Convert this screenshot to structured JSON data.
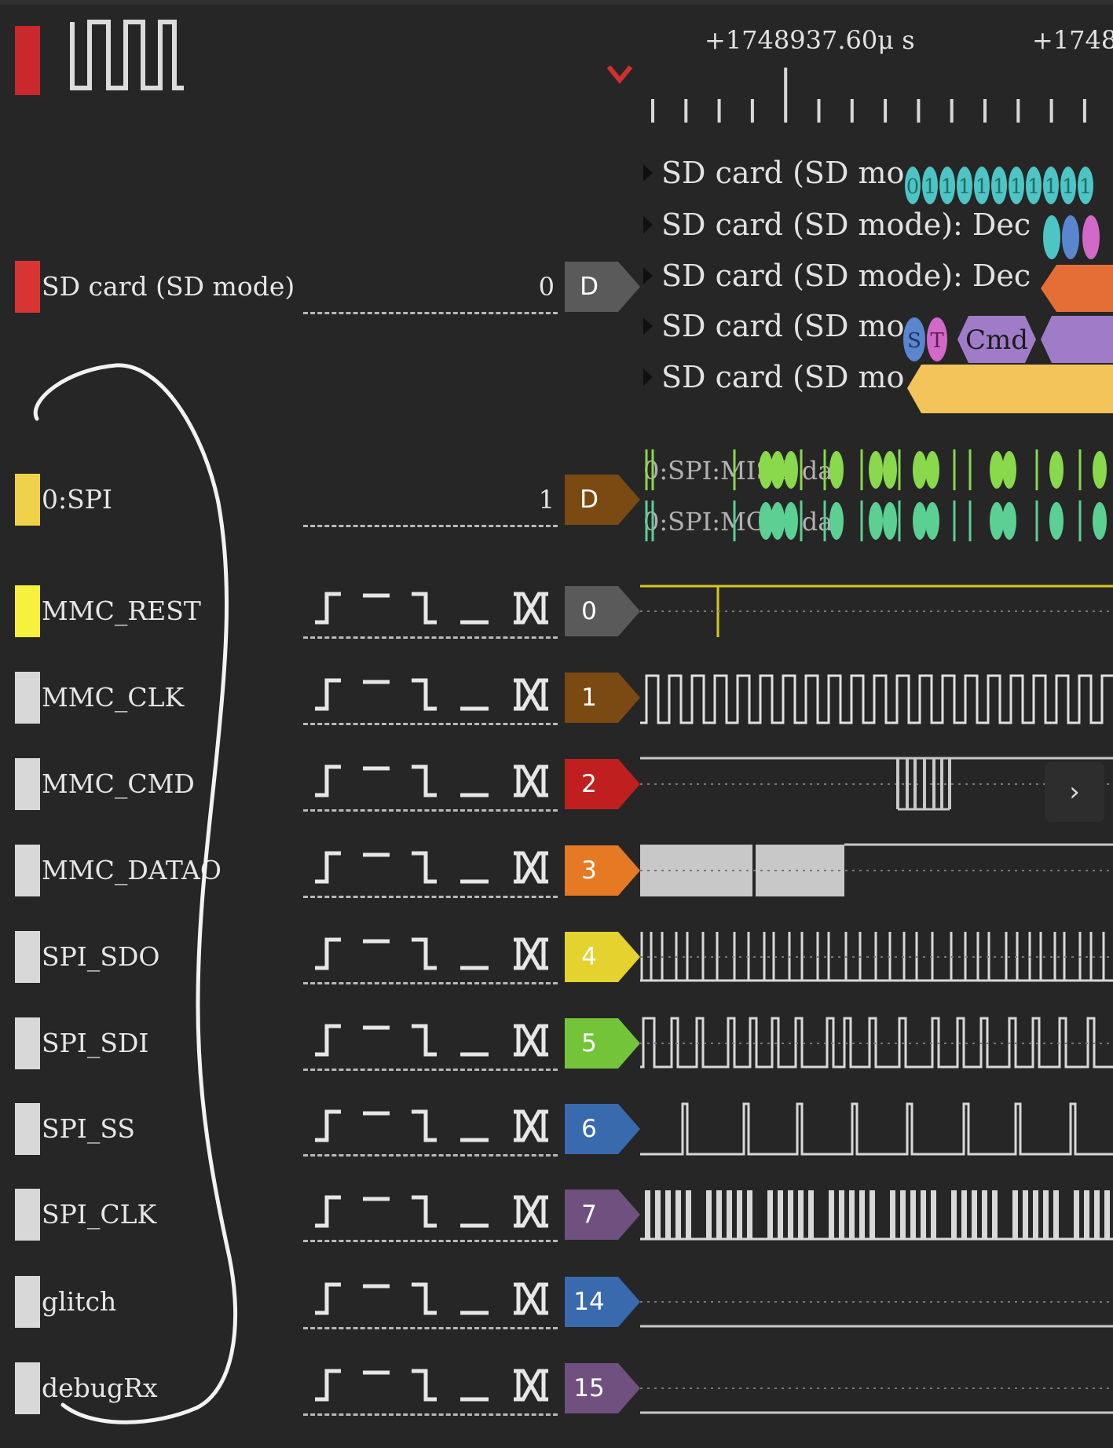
{
  "app": {
    "logo_icon": "square-wave-logo-icon",
    "accent_color": "#c9282d"
  },
  "timeline": {
    "timestamps": [
      "+1748937.60μ s",
      "+1748"
    ],
    "marker_icon": "trigger-marker-icon"
  },
  "channels": [
    {
      "key": "sd",
      "name": "SD card (SD mode)",
      "swatch_color": "#d93434",
      "value": "0",
      "tag": "D",
      "tag_color": "#5a5a5a",
      "kind": "decoder"
    },
    {
      "key": "spi",
      "name": "0:SPI",
      "swatch_color": "#f0d24a",
      "value": "1",
      "tag": "D",
      "tag_color": "#7a4a12",
      "kind": "decoder"
    },
    {
      "key": "rest",
      "name": "MMC_REST",
      "swatch_color": "#f5f13c",
      "tag": "0",
      "tag_color": "#5a5a5a",
      "kind": "logic"
    },
    {
      "key": "clk",
      "name": "MMC_CLK",
      "swatch_color": "#d8d8d8",
      "tag": "1",
      "tag_color": "#7a4a12",
      "kind": "logic"
    },
    {
      "key": "cmd",
      "name": "MMC_CMD",
      "swatch_color": "#d8d8d8",
      "tag": "2",
      "tag_color": "#c01f1f",
      "kind": "logic"
    },
    {
      "key": "data0",
      "name": "MMC_DATAO",
      "swatch_color": "#d8d8d8",
      "tag": "3",
      "tag_color": "#e67a24",
      "kind": "logic"
    },
    {
      "key": "sdo",
      "name": "SPI_SDO",
      "swatch_color": "#d8d8d8",
      "tag": "4",
      "tag_color": "#e4d22e",
      "kind": "logic"
    },
    {
      "key": "sdi",
      "name": "SPI_SDI",
      "swatch_color": "#d8d8d8",
      "tag": "5",
      "tag_color": "#74c43a",
      "kind": "logic"
    },
    {
      "key": "ss",
      "name": "SPI_SS",
      "swatch_color": "#d8d8d8",
      "tag": "6",
      "tag_color": "#3a6aae",
      "kind": "logic"
    },
    {
      "key": "sclk",
      "name": "SPI_CLK",
      "swatch_color": "#d8d8d8",
      "tag": "7",
      "tag_color": "#70507e",
      "kind": "logic"
    },
    {
      "key": "glitch",
      "name": "glitch",
      "swatch_color": "#d8d8d8",
      "tag": "14",
      "tag_color": "#3a6aae",
      "kind": "logic"
    },
    {
      "key": "debugrx",
      "name": "debugRx",
      "swatch_color": "#d8d8d8",
      "tag": "15",
      "tag_color": "#70507e",
      "kind": "logic"
    }
  ],
  "trigger_icons": [
    "rising-edge-icon",
    "high-level-icon",
    "falling-edge-icon",
    "low-level-icon",
    "any-edge-icon"
  ],
  "decoder_rows": [
    {
      "label": "SD card (SD mo",
      "annotation": ""
    },
    {
      "label": "SD card (SD mode): Dec",
      "annotation": ""
    },
    {
      "label": "SD card (SD mode): Dec",
      "annotation": ""
    },
    {
      "label": "SD card (SD mo",
      "annotation": "Cmd"
    },
    {
      "label": "SD card (SD mo",
      "annotation": ""
    }
  ],
  "spi_rows": [
    {
      "label": "0:SPI:MISO dat"
    },
    {
      "label": "0:SPI:MOSI dat"
    }
  ],
  "spi_short": [
    "S",
    "T"
  ],
  "bits": [
    "0",
    "1",
    "1",
    "1",
    "1",
    "1",
    "1",
    "1",
    "1",
    "1",
    "1",
    "1"
  ],
  "scroll_button": {
    "icon": "chevron-right-icon",
    "glyph": "›"
  }
}
